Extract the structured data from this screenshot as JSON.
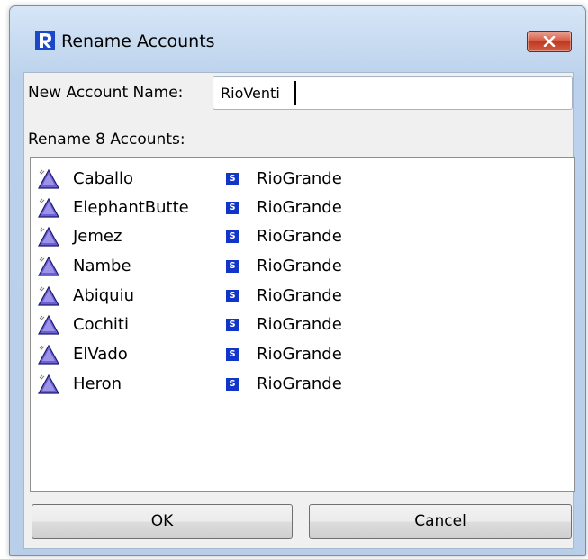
{
  "window": {
    "title": "Rename Accounts"
  },
  "form": {
    "name_label": "New Account Name:",
    "name_value": "RioVenti",
    "count_label": "Rename 8 Accounts:"
  },
  "accounts": [
    {
      "object": "Caballo",
      "account": "RioGrande",
      "icon": "reservoir-icon",
      "account_icon": "storage-account-icon",
      "account_icon_glyph": "S"
    },
    {
      "object": "ElephantButte",
      "account": "RioGrande",
      "icon": "reservoir-icon",
      "account_icon": "storage-account-icon",
      "account_icon_glyph": "S"
    },
    {
      "object": "Jemez",
      "account": "RioGrande",
      "icon": "reservoir-icon",
      "account_icon": "storage-account-icon",
      "account_icon_glyph": "S"
    },
    {
      "object": "Nambe",
      "account": "RioGrande",
      "icon": "reservoir-icon",
      "account_icon": "storage-account-icon",
      "account_icon_glyph": "S"
    },
    {
      "object": "Abiquiu",
      "account": "RioGrande",
      "icon": "reservoir-icon",
      "account_icon": "storage-account-icon",
      "account_icon_glyph": "S"
    },
    {
      "object": "Cochiti",
      "account": "RioGrande",
      "icon": "reservoir-icon",
      "account_icon": "storage-account-icon",
      "account_icon_glyph": "S"
    },
    {
      "object": "ElVado",
      "account": "RioGrande",
      "icon": "reservoir-icon",
      "account_icon": "storage-account-icon",
      "account_icon_glyph": "S"
    },
    {
      "object": "Heron",
      "account": "RioGrande",
      "icon": "reservoir-icon",
      "account_icon": "storage-account-icon",
      "account_icon_glyph": "S"
    }
  ],
  "buttons": {
    "ok_label": "OK",
    "cancel_label": "Cancel"
  },
  "colors": {
    "account_icon_bg": "#1235c9",
    "reservoir_fill": "#6c5fd6",
    "close_button": "#c0381f"
  }
}
